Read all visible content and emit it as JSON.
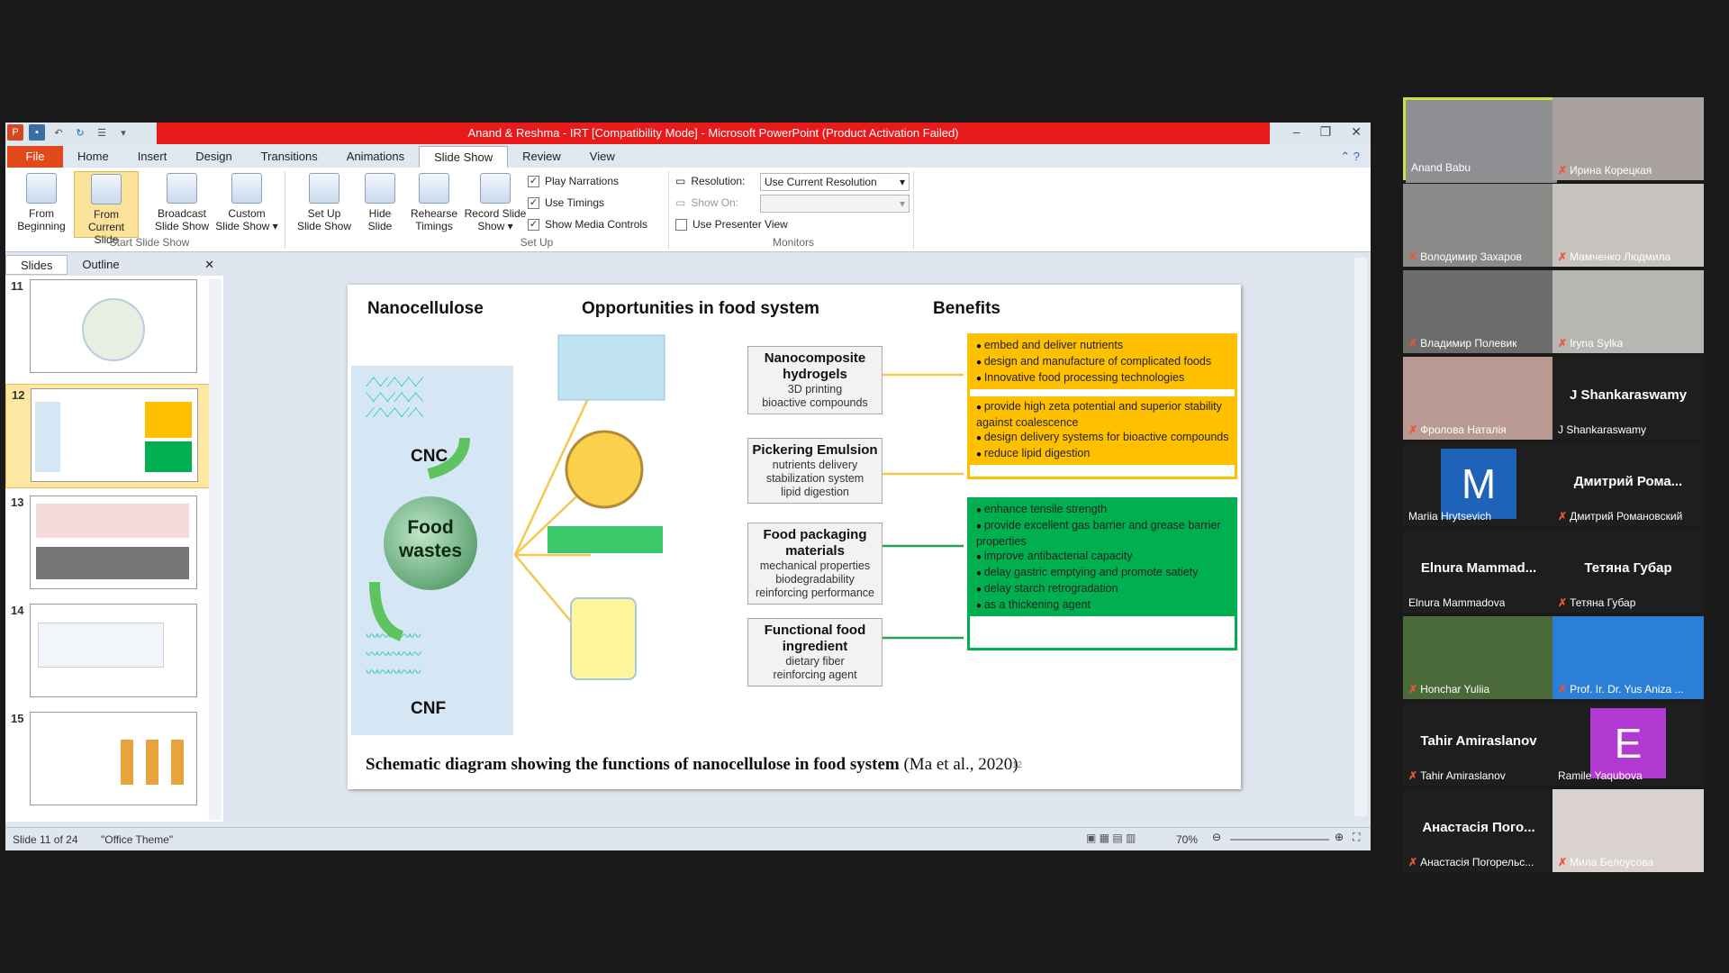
{
  "window": {
    "title": "Anand & Reshma - IRT [Compatibility Mode]  -  Microsoft PowerPoint (Product Activation Failed)"
  },
  "tabs": [
    "File",
    "Home",
    "Insert",
    "Design",
    "Transitions",
    "Animations",
    "Slide Show",
    "Review",
    "View"
  ],
  "ribbon": {
    "buttons": [
      {
        "l1": "From",
        "l2": "Beginning"
      },
      {
        "l1": "From",
        "l2": "Current Slide"
      },
      {
        "l1": "Broadcast",
        "l2": "Slide Show"
      },
      {
        "l1": "Custom",
        "l2": "Slide Show ▾"
      },
      {
        "l1": "Set Up",
        "l2": "Slide Show"
      },
      {
        "l1": "Hide",
        "l2": "Slide"
      },
      {
        "l1": "Rehearse",
        "l2": "Timings"
      },
      {
        "l1": "Record Slide",
        "l2": "Show ▾"
      }
    ],
    "groups": {
      "start": "Start Slide Show",
      "setup": "Set Up",
      "monitors": "Monitors"
    },
    "checks": {
      "narr": "Play Narrations",
      "timing": "Use Timings",
      "media": "Show Media Controls",
      "presenter": "Use Presenter View"
    },
    "resolution_label": "Resolution:",
    "resolution_value": "Use Current Resolution",
    "showon_label": "Show On:"
  },
  "panel": {
    "tabs": [
      "Slides",
      "Outline"
    ],
    "nums": [
      "11",
      "12",
      "13",
      "14",
      "15"
    ]
  },
  "slide": {
    "h1": "Nanocellulose",
    "h2": "Opportunities in food system",
    "h3": "Benefits",
    "cnc": "CNC",
    "cnf": "CNF",
    "food": "Food",
    "wastes": "wastes",
    "boxes": [
      {
        "t": "Nanocomposite hydrogels",
        "s1": "3D printing",
        "s2": "bioactive compounds"
      },
      {
        "t": "Pickering Emulsion",
        "s1": "nutrients delivery",
        "s2": "stabilization system",
        "s3": "lipid digestion"
      },
      {
        "t": "Food packaging materials",
        "s1": "mechanical properties",
        "s2": "biodegradability",
        "s3": "reinforcing performance"
      },
      {
        "t": "Functional food ingredient",
        "s1": "dietary fiber",
        "s2": "reinforcing agent"
      }
    ],
    "b1": [
      "embed and deliver nutrients",
      "design and manufacture of complicated foods",
      "Innovative food processing technologies"
    ],
    "b2": [
      "provide high zeta potential and superior stability against coalescence",
      "design delivery systems for bioactive compounds",
      "reduce lipid digestion"
    ],
    "b3": [
      "enhance tensile strength",
      "provide excellent gas barrier and grease barrier properties",
      "improve antibacterial capacity"
    ],
    "b4": [
      "delay gastric emptying and promote satiety",
      "delay starch retrogradation",
      "as a thickening agent"
    ],
    "caption_bold": "Schematic diagram showing the functions of nanocellulose in food system",
    "caption_ref": "(Ma et al., 2020)",
    "pagenum": "12",
    "colors": {
      "yellow": "#ffc000",
      "green": "#00b050"
    }
  },
  "status": {
    "slide": "Slide 11 of 24",
    "theme": "\"Office Theme\"",
    "zoom": "70%"
  },
  "participants": [
    {
      "name": "Anand Babu",
      "kind": "video"
    },
    {
      "name": "Ирина Корецкая",
      "kind": "video"
    },
    {
      "name": "Володимир Захаров",
      "kind": "video"
    },
    {
      "name": "Мамченко Людмила",
      "kind": "video"
    },
    {
      "name": "Владимир Полевик",
      "kind": "video"
    },
    {
      "name": "Iryna Sylka",
      "kind": "video"
    },
    {
      "name": "Фролова Наталія",
      "kind": "video"
    },
    {
      "name": "J Shankaraswamy",
      "big": "J Shankaraswamy",
      "kind": "text"
    },
    {
      "name": "Mariia Hrytsevich",
      "avatar": "M",
      "kind": "avatar"
    },
    {
      "name": "Дмитрий Романовский",
      "big": "Дмитрий Рома...",
      "kind": "text"
    },
    {
      "name": "Elnura Mammadova",
      "big": "Elnura Mammad...",
      "kind": "text"
    },
    {
      "name": "Тетяна Губар",
      "big": "Тетяна Губар",
      "kind": "text"
    },
    {
      "name": "Honchar Yuliia",
      "kind": "video"
    },
    {
      "name": "Prof. Ir. Dr. Yus Aniza ...",
      "kind": "video"
    },
    {
      "name": "Tahir Amiraslanov",
      "big": "Tahir Amiraslanov",
      "kind": "text"
    },
    {
      "name": "Ramile Yaqubova",
      "avatar": "E",
      "kind": "avatar"
    },
    {
      "name": "Анастасія Погорельс...",
      "big": "Анастасія Пого...",
      "kind": "text"
    },
    {
      "name": "Мила Белоусова",
      "kind": "video"
    }
  ]
}
